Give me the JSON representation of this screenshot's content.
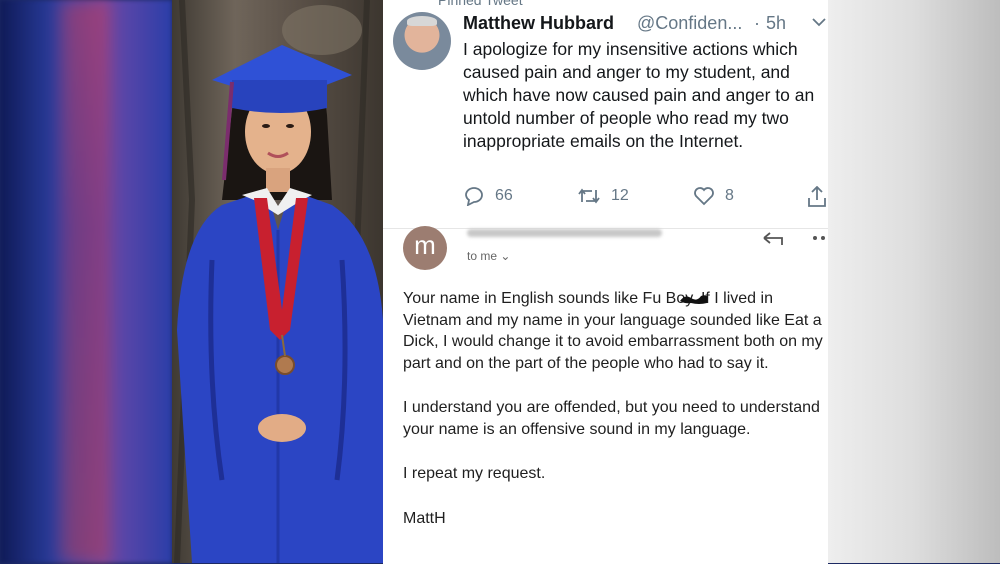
{
  "tweet": {
    "pinned_label": "Pinned Tweet",
    "author_name": "Matthew Hubbard",
    "author_handle": "@Confiden...",
    "separator": "·",
    "time": "5h",
    "text": "I apologize for my insensitive actions which caused pain and anger to my student, and which have now caused pain and anger to an untold number of people who read my two inappropriate emails on the Internet.",
    "replies": "66",
    "retweets": "12",
    "likes": "8"
  },
  "email": {
    "avatar_letter": "m",
    "recipient": "to me ⌄",
    "paragraphs": [
      "Your name in English sounds like Fu Boy. If I lived in Vietnam and my name in your language sounded like Eat a Dick, I would change it to avoid embarrassment both on my part and on the part of the people who had to say it.",
      "I understand you are offended, but you need to understand your name is an offensive sound in my language.",
      "I repeat my request.",
      "MattH"
    ]
  },
  "colors": {
    "gown_blue": "#2b45c4",
    "sash_red": "#c8202f",
    "muted_text": "#657786"
  },
  "icons": [
    "reply-icon",
    "retweet-icon",
    "like-icon",
    "share-icon",
    "chevron-down-icon",
    "more-icon"
  ]
}
